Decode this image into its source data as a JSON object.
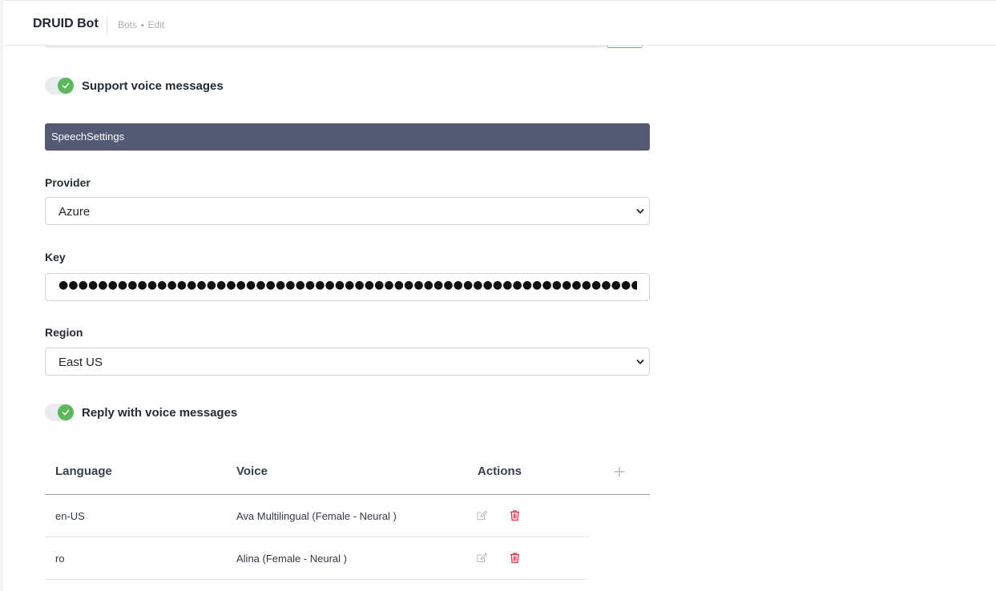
{
  "header": {
    "app_title": "DRUID Bot",
    "breadcrumb": [
      "Bots",
      "Edit"
    ]
  },
  "support_voice": {
    "label": "Support voice messages",
    "enabled": true
  },
  "speech_settings": {
    "section_title": "SpeechSettings",
    "provider": {
      "label": "Provider",
      "value": "Azure"
    },
    "key": {
      "label": "Key",
      "masked_value": "●●●●●●●●●●●●●●●●●●●●●●●●●●●●●●●●●●●●●●●●●●●●●●●●●●●●●●●●●●●●●●●●●●●●●●●●●●●●●●●●●●●●●●●●●●●●●●●●●"
    },
    "region": {
      "label": "Region",
      "value": "East US"
    }
  },
  "reply_voice": {
    "label": "Reply with voice messages",
    "enabled": true
  },
  "voices_table": {
    "columns": {
      "language": "Language",
      "voice": "Voice",
      "actions": "Actions"
    },
    "rows": [
      {
        "language": "en-US",
        "voice": "Ava Multilingual (Female - Neural )"
      },
      {
        "language": "ro",
        "voice": "Alina (Female - Neural )"
      }
    ]
  },
  "icons": {
    "toggle_check": "check-icon",
    "select_arrow": "chevron-down-icon",
    "add": "plus-icon",
    "edit": "edit-icon",
    "delete": "trash-icon"
  },
  "colors": {
    "section_header_bg": "#545a74",
    "toggle_on": "#5cb85c",
    "delete_red": "#e0334a",
    "edit_gray": "#b7bcc4"
  }
}
